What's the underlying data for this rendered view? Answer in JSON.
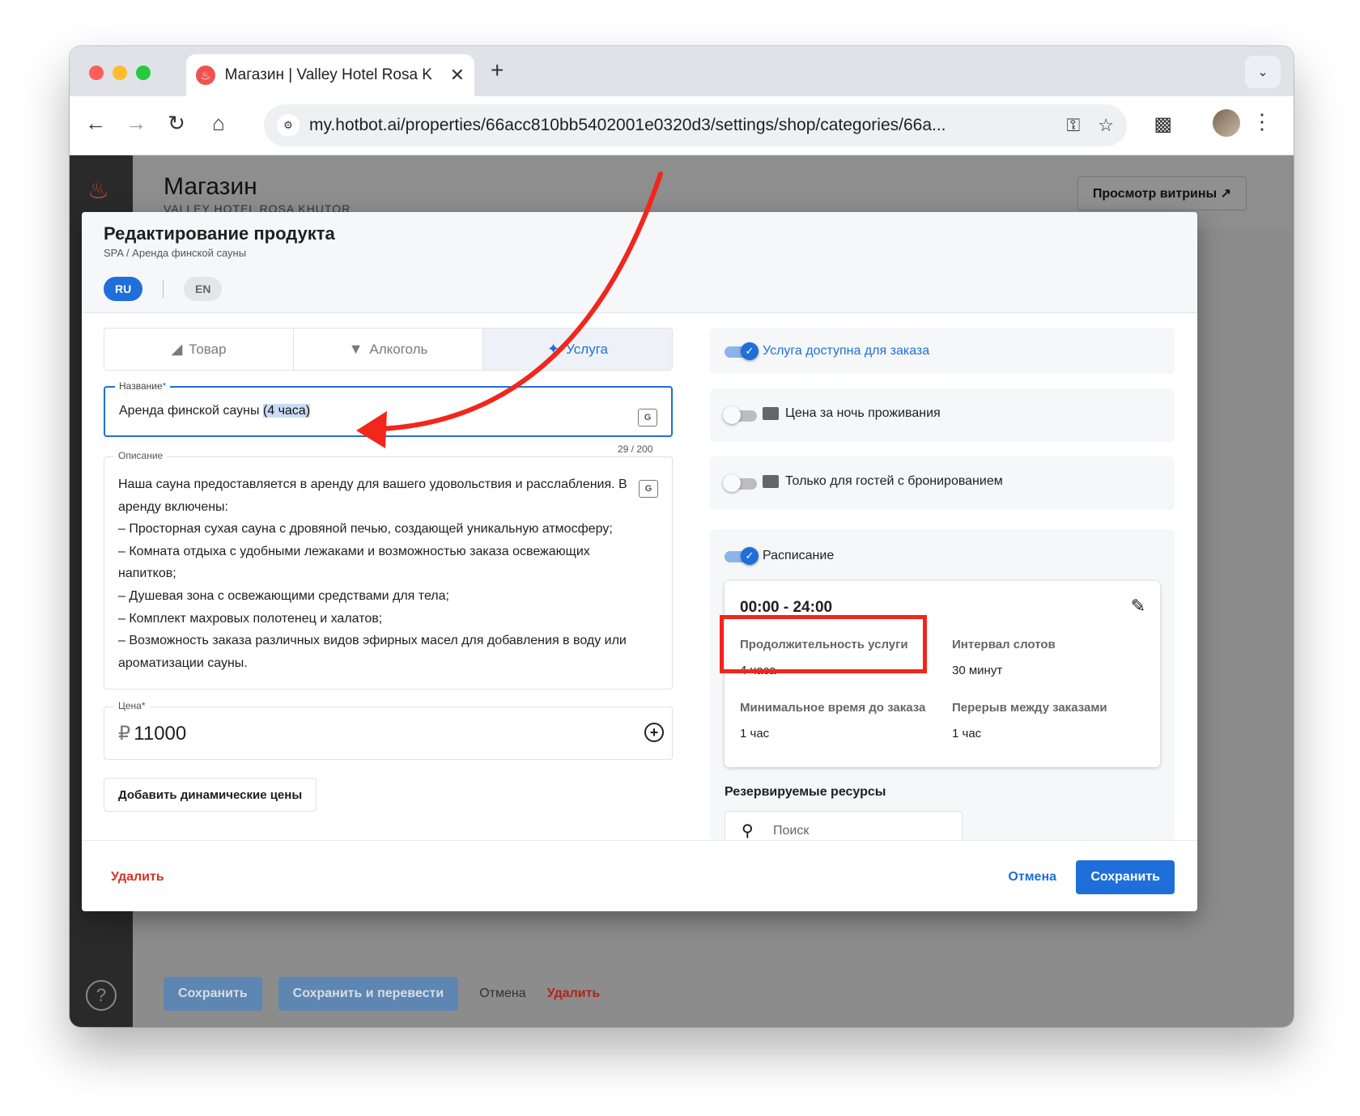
{
  "browser": {
    "tab_title": "Магазин | Valley Hotel Rosa K",
    "url": "my.hotbot.ai/properties/66acc810bb5402001e0320d3/settings/shop/categories/66a..."
  },
  "background": {
    "title": "Магазин",
    "subtitle": "VALLEY HOTEL ROSA KHUTOR",
    "storefront_button": "Просмотр витрины ↗",
    "footer": {
      "save": "Сохранить",
      "save_translate": "Сохранить и перевести",
      "cancel": "Отмена",
      "delete": "Удалить"
    }
  },
  "modal": {
    "title": "Редактирование продукта",
    "breadcrumb": "SPA / Аренда финской сауны",
    "languages": [
      "RU",
      "EN"
    ],
    "type_tabs": [
      {
        "label": "Товар",
        "icon": "basket-icon"
      },
      {
        "label": "Алкоголь",
        "icon": "cocktail-icon"
      },
      {
        "label": "Услуга",
        "icon": "person-service-icon",
        "active": true
      }
    ],
    "name_label": "Название",
    "name_value_plain": "Аренда финской сауны ",
    "name_value_selected": "(4 часа)",
    "name_counter": "29 / 200",
    "description_label": "Описание",
    "description_lines": [
      "Наша сауна предоставляется в аренду для вашего удовольствия и расслабления. В",
      "аренду включены:",
      "– Просторная сухая сауна с дровяной печью, создающей уникальную атмосферу;",
      "– Комната отдыха с удобными лежаками и возможностью заказа освежающих",
      "напитков;",
      "– Душевая зона с освежающими средствами для тела;",
      "– Комплект махровых полотенец и халатов;",
      "– Возможность заказа различных видов эфирных масел для добавления в воду или",
      "ароматизации сауны."
    ],
    "price_label": "Цена",
    "price_currency": "₽",
    "price_value": "11000",
    "dynamic_prices_button": "Добавить динамические цены",
    "options": {
      "available": "Услуга доступна для заказа",
      "per_night": "Цена за ночь проживания",
      "guests_only": "Только для гостей с бронированием",
      "schedule": "Расписание"
    },
    "schedule": {
      "time": "00:00 - 24:00",
      "duration_label": "Продолжительность услуги",
      "duration_value": "4 часа",
      "interval_label": "Интервал слотов",
      "interval_value": "30 минут",
      "min_time_label": "Минимальное время до заказа",
      "min_time_value": "1 час",
      "break_label": "Перерыв между заказами",
      "break_value": "1 час"
    },
    "resources_title": "Резервируемые ресурсы",
    "search_placeholder": "Поиск",
    "footer": {
      "delete": "Удалить",
      "cancel": "Отмена",
      "save": "Сохранить"
    }
  },
  "colors": {
    "accent": "#1e6fd9",
    "annotation_red": "#f2261b",
    "danger": "#d93025"
  }
}
